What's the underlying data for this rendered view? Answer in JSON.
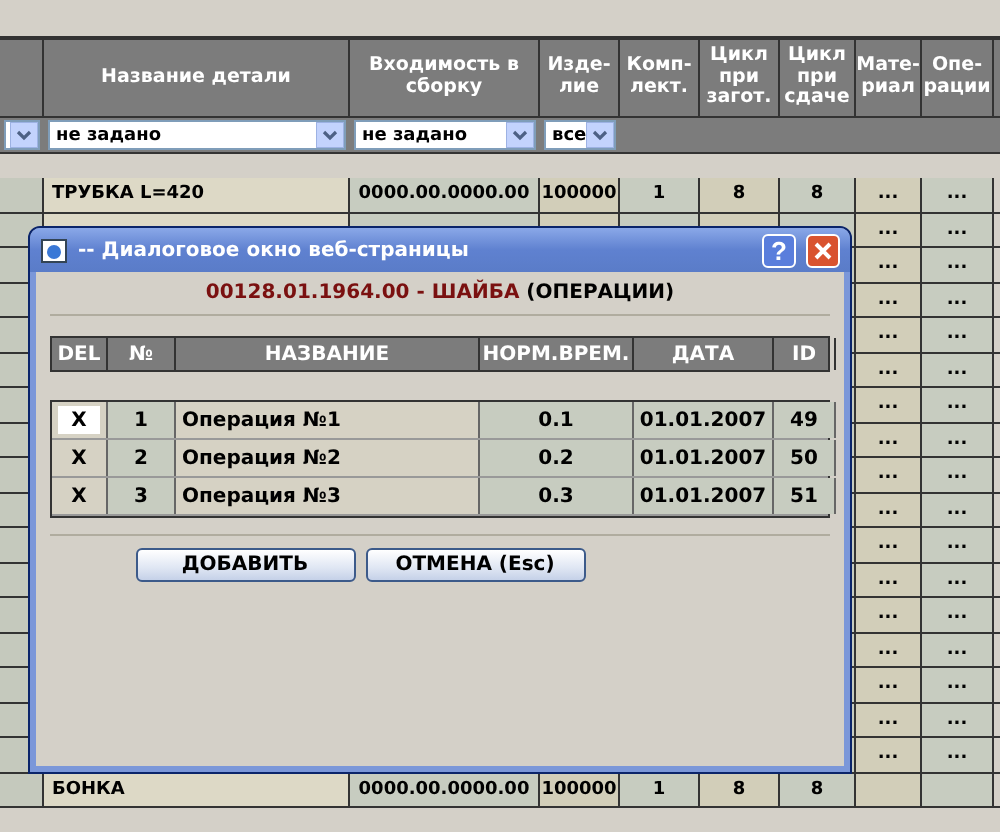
{
  "grid": {
    "columns": [
      "Название детали",
      "Входимость в сборку",
      "Изде-лие",
      "Комп-лект.",
      "Цикл при загот.",
      "Цикл при сдаче",
      "Мате-риал",
      "Опе-рации"
    ],
    "filters": [
      {
        "kind": "select"
      },
      {
        "kind": "select",
        "value": "не задано"
      },
      {
        "kind": "select",
        "value": "не задано"
      },
      {
        "kind": "select",
        "value": "все"
      }
    ],
    "rows": [
      {
        "name": "ТРУБКА L=420",
        "assembly": "0000.00.0000.00",
        "product": "100000",
        "kit": "1",
        "cycle_prep": "8",
        "cycle_deliver": "8",
        "material": "...",
        "operations": "..."
      },
      {
        "material": "...",
        "operations": "..."
      },
      {
        "material": "...",
        "operations": "..."
      },
      {
        "material": "...",
        "operations": "..."
      },
      {
        "material": "...",
        "operations": "..."
      },
      {
        "material": "...",
        "operations": "..."
      },
      {
        "material": "...",
        "operations": "..."
      },
      {
        "material": "...",
        "operations": "..."
      },
      {
        "material": "...",
        "operations": "..."
      },
      {
        "material": "...",
        "operations": "..."
      },
      {
        "material": "...",
        "operations": "..."
      },
      {
        "material": "...",
        "operations": "..."
      },
      {
        "material": "...",
        "operations": "..."
      },
      {
        "material": "...",
        "operations": "..."
      },
      {
        "material": "...",
        "operations": "..."
      },
      {
        "material": "...",
        "operations": "..."
      },
      {
        "material": "...",
        "operations": "..."
      },
      {
        "name": "БОНКА",
        "assembly": "0000.00.0000.00",
        "product": "100000",
        "kit": "1",
        "cycle_prep": "8",
        "cycle_deliver": "8"
      }
    ]
  },
  "dialog": {
    "title": "-- Диалоговое окно веб-страницы",
    "help": "?",
    "code_title": "00128.01.1964.00 - ШАЙБА",
    "section": "(ОПЕРАЦИИ)",
    "columns": [
      "DEL",
      "№",
      "НАЗВАНИЕ",
      "НОРМ.ВРЕМ.",
      "ДАТА",
      "ID"
    ],
    "rows": [
      {
        "delete": "X",
        "focused": true,
        "number": "1",
        "name": "Операция №1",
        "time": "0.1",
        "date": "01.01.2007",
        "id": "49"
      },
      {
        "delete": "X",
        "focused": false,
        "number": "2",
        "name": "Операция №2",
        "time": "0.2",
        "date": "01.01.2007",
        "id": "50"
      },
      {
        "delete": "X",
        "focused": false,
        "number": "3",
        "name": "Операция №3",
        "time": "0.3",
        "date": "01.01.2007",
        "id": "51"
      }
    ],
    "buttons": [
      "ДОБАВИТЬ",
      "ОТМЕНА (Esc)"
    ]
  }
}
